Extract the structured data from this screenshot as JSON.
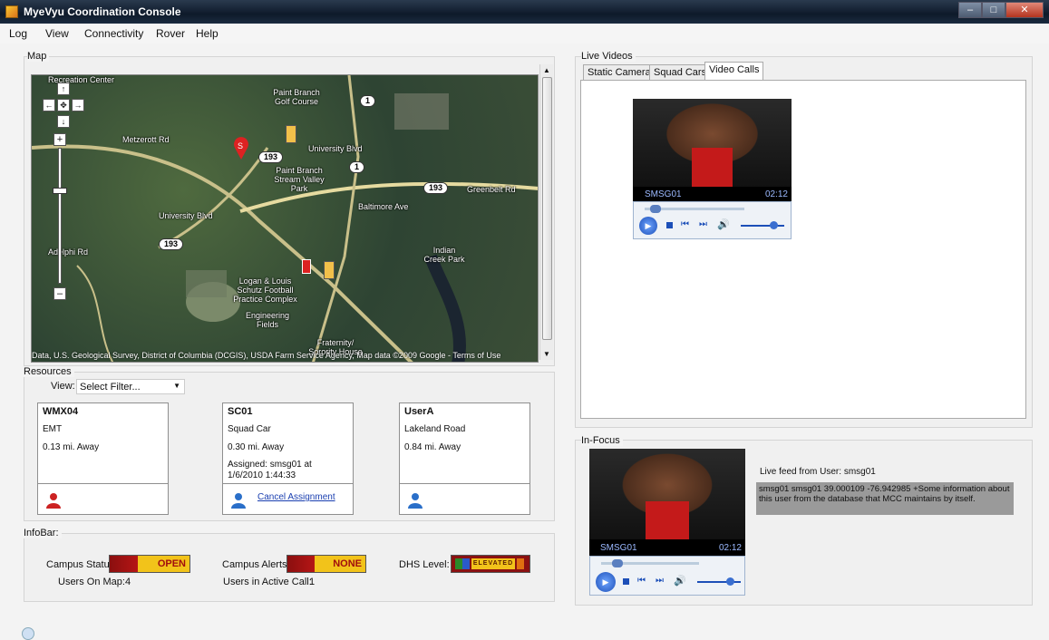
{
  "window": {
    "title": "MyeVyu Coordination Console"
  },
  "menu": [
    "Log",
    "View",
    "Connectivity",
    "Rover",
    "Help"
  ],
  "map": {
    "group_label": "Map",
    "labels": [
      "Recreation Center",
      "Paint Branch Golf Course",
      "University Blvd",
      "Metzerott Rd",
      "Paint Branch Stream Valley Park",
      "Greenbelt Rd",
      "Baltimore Ave",
      "Indian Creek Park",
      "Logan & Louis Schutz Football Practice Complex",
      "Engineering Fields",
      "Fraternity/ Sorority House",
      "University Blvd",
      "Adelphi Rd"
    ],
    "shields": [
      "193",
      "1",
      "193",
      "1",
      "193"
    ],
    "attribution": "Data, U.S. Geological Survey, District of Columbia (DCGIS), USDA Farm Service Agency, Map data ©2009 Google - Terms of Use"
  },
  "resources": {
    "group_label": "Resources",
    "view_label": "View:",
    "filter_value": "Select Filter...",
    "cards": [
      {
        "name": "WMX04",
        "type": "EMT",
        "distance": "0.13 mi. Away",
        "assigned": "",
        "action": "",
        "icon": "person-red-icon",
        "icon_color": "#cc2222"
      },
      {
        "name": "SC01",
        "type": "Squad Car",
        "distance": "0.30 mi. Away",
        "assigned": "Assigned: smsg01 at 1/6/2010 1:44:33",
        "action": "Cancel Assignment",
        "icon": "person-blue-icon",
        "icon_color": "#2a6fc9"
      },
      {
        "name": "UserA",
        "type": "Lakeland Road",
        "distance": "0.84 mi. Away",
        "assigned": "",
        "action": "",
        "icon": "person-blue-icon",
        "icon_color": "#2a6fc9"
      }
    ]
  },
  "infobar": {
    "group_label": "InfoBar:",
    "campus_status_label": "Campus Status:",
    "campus_status_value": "OPEN",
    "campus_alerts_label": "Campus Alerts:",
    "campus_alerts_value": "NONE",
    "dhs_label": "DHS Level:",
    "dhs_value": "ELEVATED",
    "users_on_map_label": "Users On Map:",
    "users_on_map_value": "4",
    "users_in_call_label": "Users in Active Call:",
    "users_in_call_value": "1"
  },
  "live_videos": {
    "group_label": "Live Videos",
    "tabs": [
      "Static Cameras",
      "Squad Cars",
      "Video Calls"
    ],
    "active_tab": "Video Calls",
    "player": {
      "user": "SMSG01",
      "time": "02:12"
    }
  },
  "in_focus": {
    "group_label": "In-Focus",
    "player": {
      "user": "SMSG01",
      "time": "02:12"
    },
    "feed_label": "Live feed from User: smsg01",
    "info_text": "smsg01 smsg01 39.000109 -76.942985 +Some information about this user from the database that MCC maintains by itself."
  }
}
